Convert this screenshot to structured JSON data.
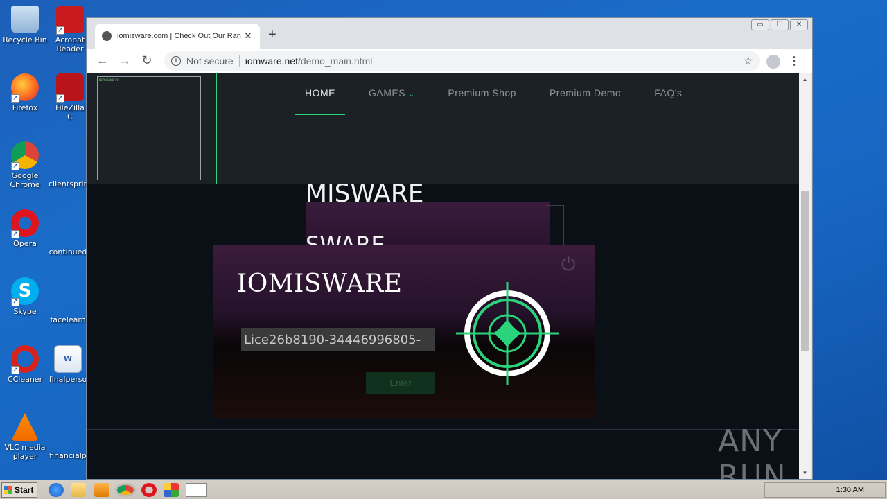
{
  "desktop": {
    "icons": [
      {
        "label": "Recycle Bin"
      },
      {
        "label": "Acrobat Reader"
      },
      {
        "label": "Firefox"
      },
      {
        "label": "FileZilla C"
      },
      {
        "label": "Google Chrome"
      },
      {
        "label": "clientsprin"
      },
      {
        "label": "Opera"
      },
      {
        "label": "continued"
      },
      {
        "label": "Skype"
      },
      {
        "label": "facelearn"
      },
      {
        "label": "CCleaner"
      },
      {
        "label": "finalperso"
      },
      {
        "label": "VLC media player"
      },
      {
        "label": "financialp"
      }
    ]
  },
  "browser": {
    "tab_title": "iomisware.com | Check Out Our Ran",
    "new_tab": "+",
    "omnibox": {
      "security": "Not secure",
      "host": "iomware.net",
      "path": "/demo_main.html"
    }
  },
  "site": {
    "logo_alt": "iomiswa re",
    "nav": {
      "home": "HOME",
      "games": "GAMES",
      "premium_shop": "Premium Shop",
      "premium_demo": "Premium Demo",
      "faq": "FAQ's"
    },
    "bg_title_1": "MISWARE",
    "bg_title_2": "SWARE",
    "panel": {
      "title": "IOMISWARE",
      "license_value": "Lice26b8190-34446996805-",
      "enter_label": "Enter"
    },
    "watermark": "ANY RUN"
  },
  "taskbar": {
    "start_label": "Start",
    "clock": "1:30 AM"
  },
  "colors": {
    "accent_green": "#2bd47a",
    "header_bg": "#1c2125",
    "panel_purple": "#3b1c3b"
  }
}
